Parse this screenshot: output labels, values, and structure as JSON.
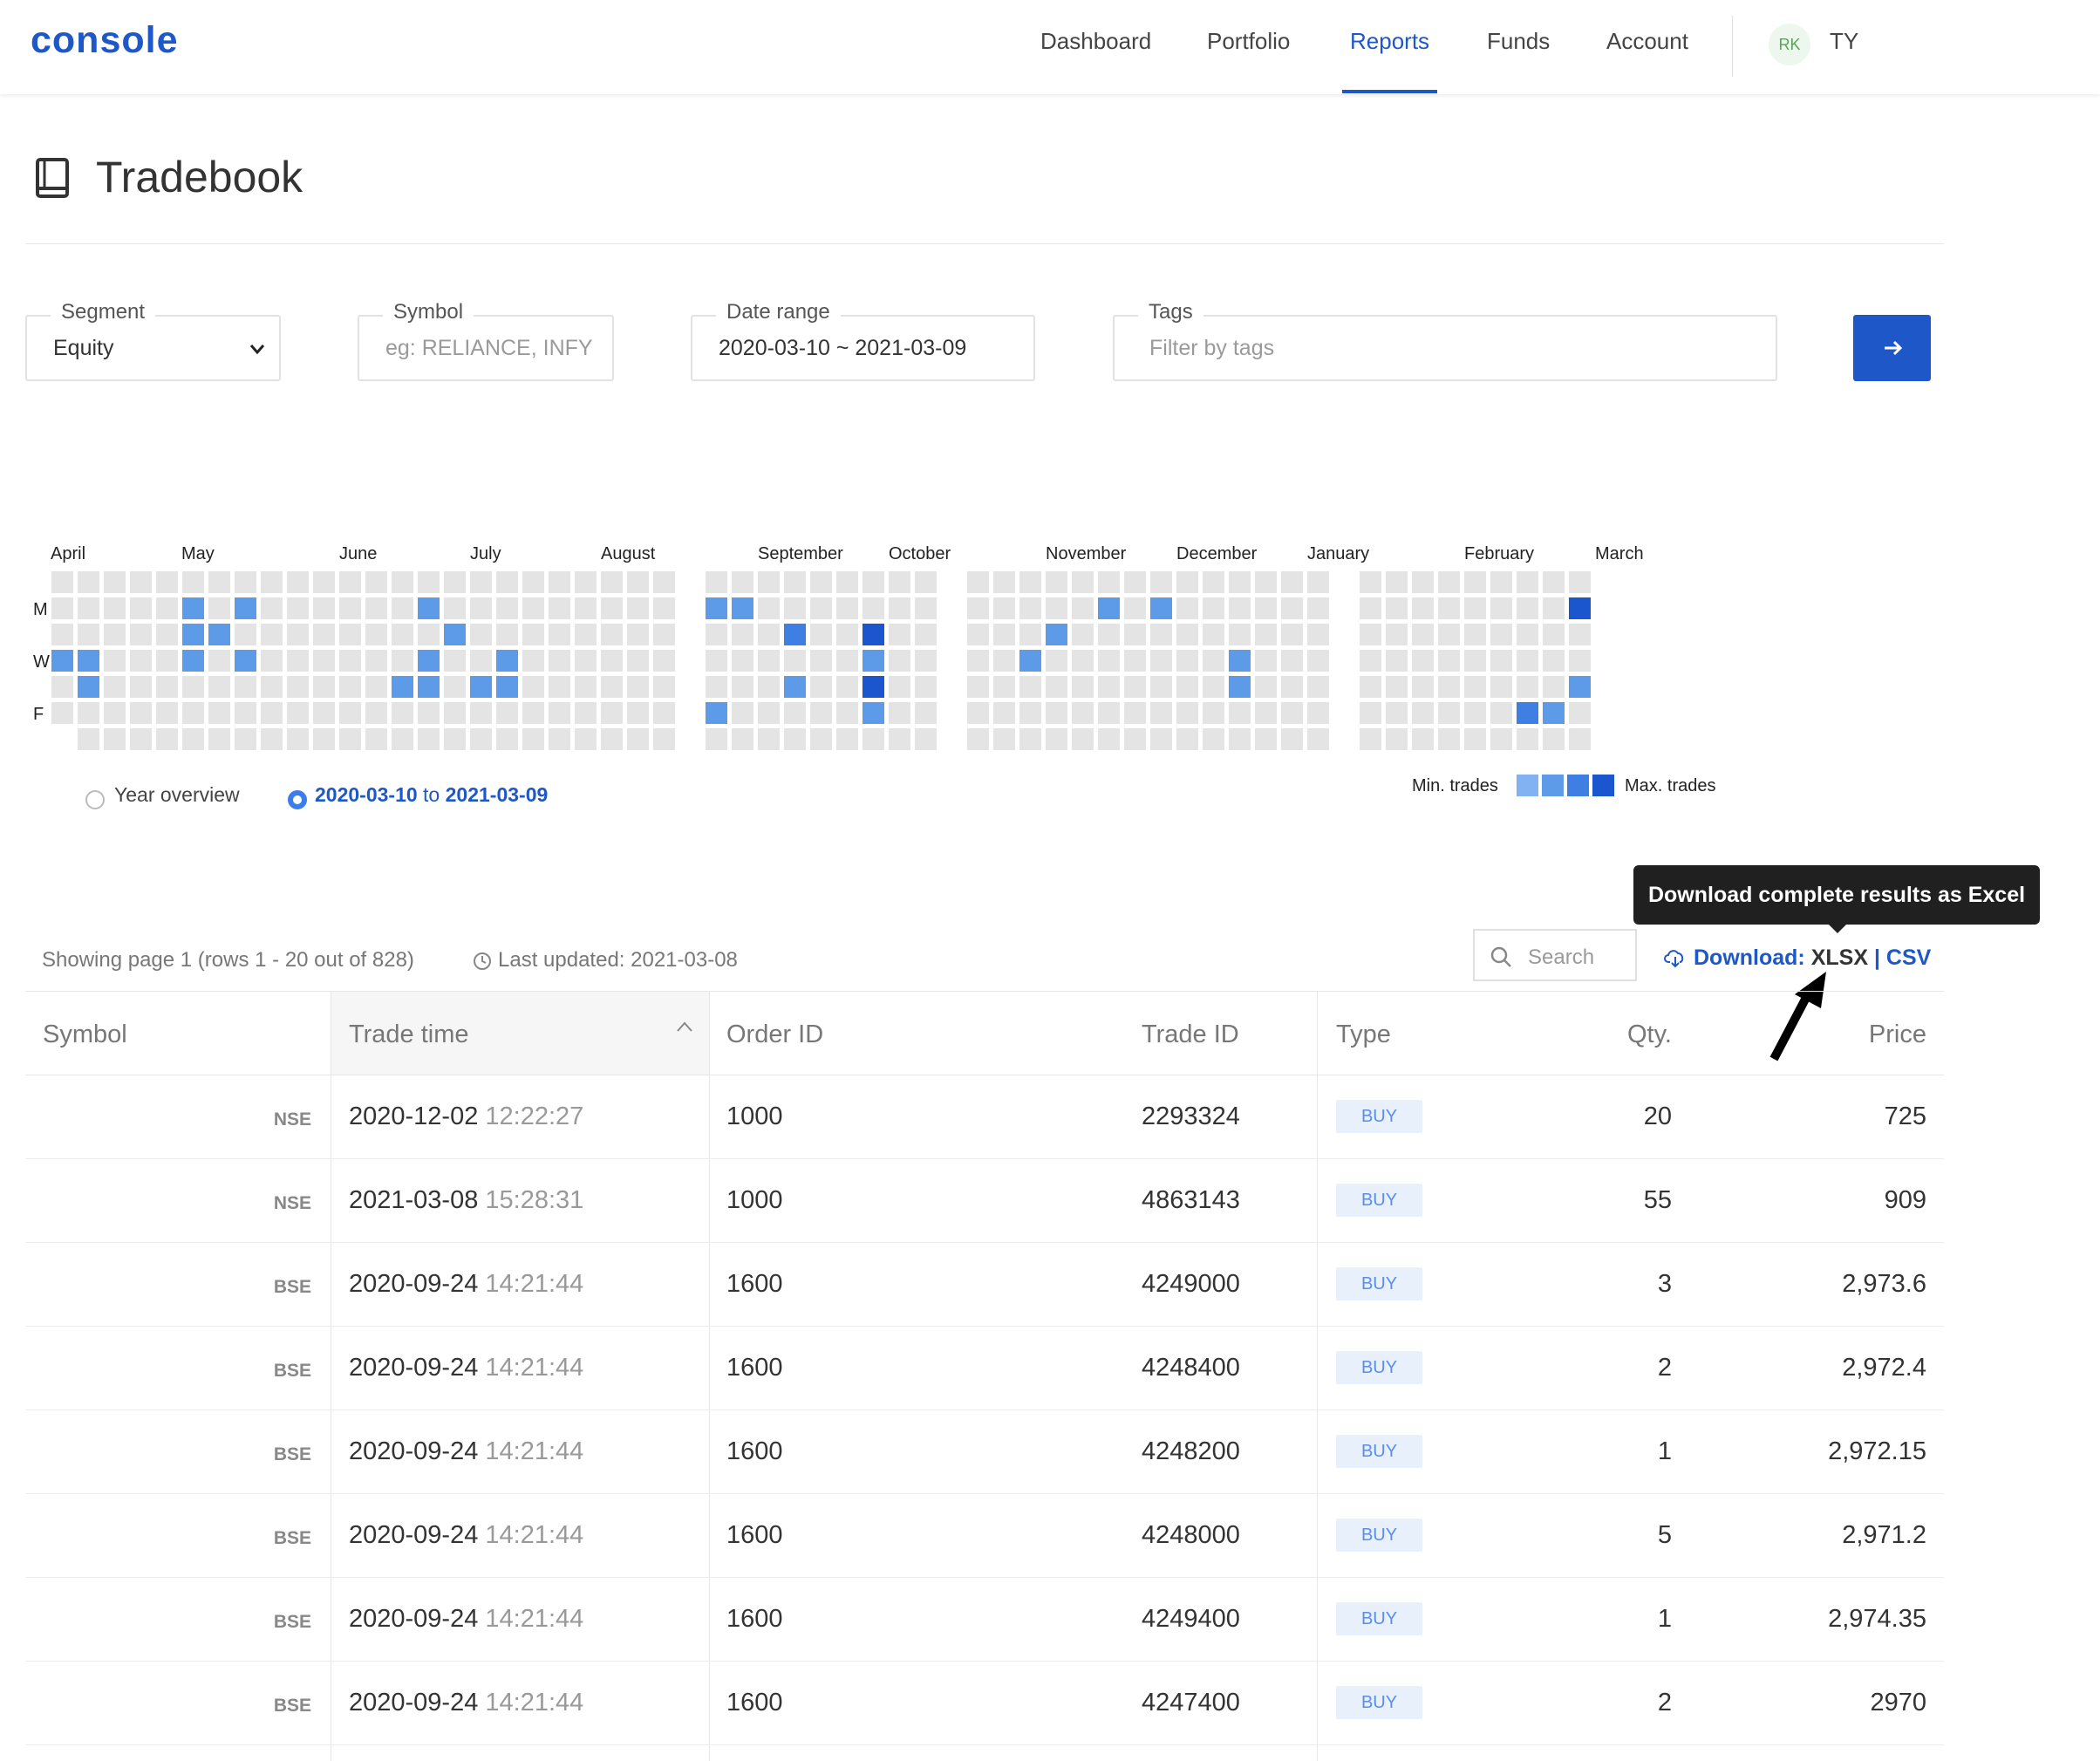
{
  "nav": {
    "logo": "console",
    "items": [
      "Dashboard",
      "Portfolio",
      "Reports",
      "Funds",
      "Account"
    ],
    "active": "Reports",
    "avatar_initials": "RK",
    "user_id_partial": "TY"
  },
  "page": {
    "title": "Tradebook"
  },
  "filters": {
    "segment": {
      "label": "Segment",
      "value": "Equity"
    },
    "symbol": {
      "label": "Symbol",
      "placeholder": "eg: RELIANCE, INFY"
    },
    "date_range": {
      "label": "Date range",
      "value": "2020-03-10 ~ 2021-03-09"
    },
    "tags": {
      "label": "Tags",
      "placeholder": "Filter by tags"
    }
  },
  "heatmap": {
    "months": [
      "April",
      "May",
      "June",
      "July",
      "August",
      "September",
      "October",
      "November",
      "December",
      "January",
      "February",
      "March"
    ],
    "day_labels": [
      "M",
      "W",
      "F"
    ],
    "view_options": {
      "year": "Year overview",
      "range_start": "2020-03-10",
      "range_sep": "to",
      "range_end": "2021-03-09"
    },
    "legend": {
      "min": "Min. trades",
      "max": "Max. trades"
    },
    "colors": {
      "empty": "#e4e4e4",
      "l1": "#83b2f2",
      "l2": "#5d9be9",
      "l3": "#3f7ee3",
      "l4": "#1b56cf"
    }
  },
  "tooltip": "Download complete results as Excel",
  "toolbar": {
    "showing": "Showing page 1 (rows 1 - 20 out of 828)",
    "last_updated": "Last updated: 2021-03-08",
    "search_placeholder": "Search",
    "download_label": "Download:",
    "xlsx": "XLSX",
    "sep": "|",
    "csv": "CSV"
  },
  "table": {
    "columns": [
      "Symbol",
      "Trade time",
      "Order ID",
      "Trade ID",
      "Type",
      "Qty.",
      "Price"
    ],
    "rows": [
      {
        "exchange": "NSE",
        "date": "2020-12-02",
        "time": "12:22:27",
        "order_id": "1000",
        "trade_id": "2293324",
        "type": "BUY",
        "qty": "20",
        "price": "725"
      },
      {
        "exchange": "NSE",
        "date": "2021-03-08",
        "time": "15:28:31",
        "order_id": "1000",
        "trade_id": "4863143",
        "type": "BUY",
        "qty": "55",
        "price": "909"
      },
      {
        "exchange": "BSE",
        "date": "2020-09-24",
        "time": "14:21:44",
        "order_id": "1600",
        "trade_id": "4249000",
        "type": "BUY",
        "qty": "3",
        "price": "2,973.6"
      },
      {
        "exchange": "BSE",
        "date": "2020-09-24",
        "time": "14:21:44",
        "order_id": "1600",
        "trade_id": "4248400",
        "type": "BUY",
        "qty": "2",
        "price": "2,972.4"
      },
      {
        "exchange": "BSE",
        "date": "2020-09-24",
        "time": "14:21:44",
        "order_id": "1600",
        "trade_id": "4248200",
        "type": "BUY",
        "qty": "1",
        "price": "2,972.15"
      },
      {
        "exchange": "BSE",
        "date": "2020-09-24",
        "time": "14:21:44",
        "order_id": "1600",
        "trade_id": "4248000",
        "type": "BUY",
        "qty": "5",
        "price": "2,971.2"
      },
      {
        "exchange": "BSE",
        "date": "2020-09-24",
        "time": "14:21:44",
        "order_id": "1600",
        "trade_id": "4249400",
        "type": "BUY",
        "qty": "1",
        "price": "2,974.35"
      },
      {
        "exchange": "BSE",
        "date": "2020-09-24",
        "time": "14:21:44",
        "order_id": "1600",
        "trade_id": "4247400",
        "type": "BUY",
        "qty": "2",
        "price": "2970"
      }
    ]
  }
}
